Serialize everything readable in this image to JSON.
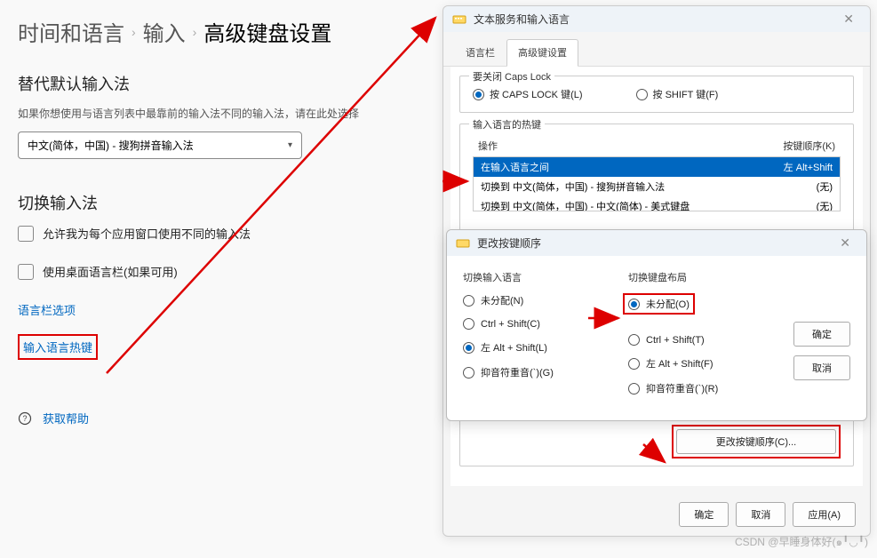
{
  "breadcrumb": {
    "p1": "时间和语言",
    "p2": "输入",
    "p3": "高级键盘设置"
  },
  "section1": {
    "title": "替代默认输入法",
    "desc": "如果你想使用与语言列表中最靠前的输入法不同的输入法，请在此处选择",
    "dropdown": "中文(简体，中国) - 搜狗拼音输入法"
  },
  "section2": {
    "title": "切换输入法",
    "cb1": "允许我为每个应用窗口使用不同的输入法",
    "cb2": "使用桌面语言栏(如果可用)",
    "link1": "语言栏选项",
    "link2": "输入语言热键"
  },
  "help": "获取帮助",
  "dialog1": {
    "title": "文本服务和输入语言",
    "tab1": "语言栏",
    "tab2": "高级键设置",
    "group1": {
      "label": "要关闭 Caps Lock",
      "r1": "按 CAPS LOCK 键(L)",
      "r2": "按 SHIFT 键(F)"
    },
    "group2": {
      "label": "输入语言的热键",
      "col1": "操作",
      "col2": "按键顺序(K)",
      "rows": [
        {
          "action": "在输入语言之间",
          "key": "左 Alt+Shift"
        },
        {
          "action": "切换到 中文(简体，中国) - 搜狗拼音输入法",
          "key": "(无)"
        },
        {
          "action": "切换到 中文(简体，中国) - 中文(简体) - 美式键盘",
          "key": "(无)"
        }
      ],
      "change_btn": "更改按键顺序(C)..."
    },
    "footer": {
      "ok": "确定",
      "cancel": "取消",
      "apply": "应用(A)"
    }
  },
  "dialog2": {
    "title": "更改按键顺序",
    "col1": {
      "label": "切换输入语言",
      "r1": "未分配(N)",
      "r2": "Ctrl + Shift(C)",
      "r3": "左 Alt + Shift(L)",
      "r4": "抑音符重音(`)(G)"
    },
    "col2": {
      "label": "切换键盘布局",
      "r1": "未分配(O)",
      "r2": "Ctrl + Shift(T)",
      "r3": "左 Alt + Shift(F)",
      "r4": "抑音符重音(`)(R)"
    },
    "ok": "确定",
    "cancel": "取消"
  },
  "watermark": "CSDN @早睡身体好(๑╹◡╹)"
}
